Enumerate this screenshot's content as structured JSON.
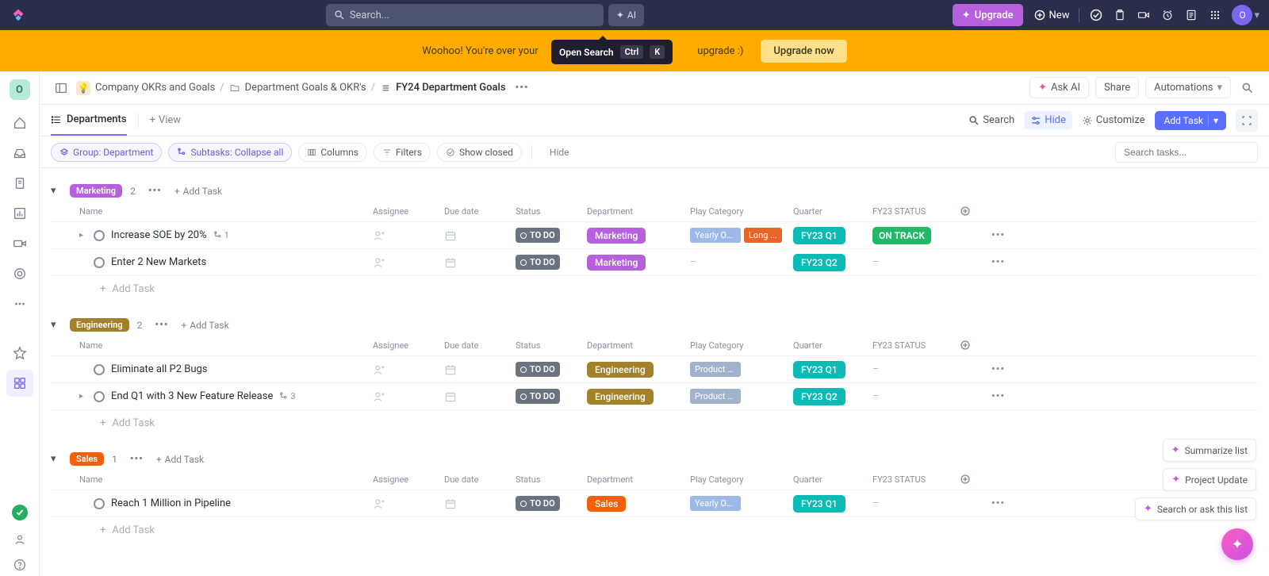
{
  "topnav": {
    "search_placeholder": "Search...",
    "ai_label": "AI",
    "upgrade_label": "Upgrade",
    "new_label": "New",
    "avatar_letter": "O"
  },
  "banner": {
    "text_left": "Woohoo! You're over your",
    "text_right": "upgrade :)",
    "upgrade_label": "Upgrade now"
  },
  "tooltip": {
    "label": "Open Search",
    "key1": "Ctrl",
    "key2": "K"
  },
  "breadcrumb": {
    "folder1": "Company OKRs and Goals",
    "folder2": "Department Goals & OKR's",
    "list": "FY24 Department Goals",
    "ask_ai": "Ask AI",
    "share": "Share",
    "automations": "Automations"
  },
  "workspace_letter": "O",
  "tabs": {
    "active": "Departments",
    "add_view": "View"
  },
  "toolbar": {
    "search": "Search",
    "hide": "Hide",
    "customize": "Customize",
    "add_task": "Add Task"
  },
  "filters": {
    "group": "Group: Department",
    "subtasks": "Subtasks: Collapse all",
    "columns": "Columns",
    "filters": "Filters",
    "show_closed": "Show closed",
    "hide": "Hide",
    "search_placeholder": "Search tasks..."
  },
  "columns": {
    "name": "Name",
    "assignee": "Assignee",
    "due": "Due date",
    "status": "Status",
    "department": "Department",
    "play": "Play Category",
    "quarter": "Quarter",
    "fy23": "FY23 STATUS"
  },
  "groups": [
    {
      "label": "Marketing",
      "pill_class": "pill-marketing",
      "count": "2",
      "tasks": [
        {
          "name": "Increase SOE by 20%",
          "has_expand": true,
          "subtasks": "1",
          "status": "TO DO",
          "department": "Marketing",
          "dept_class": "dept-marketing",
          "plays": [
            {
              "text": "Yearly OK...",
              "cls": "blue"
            },
            {
              "text": "Long ...",
              "cls": "orange"
            }
          ],
          "quarter": "FY23 Q1",
          "fy23": "ON TRACK"
        },
        {
          "name": "Enter 2 New Markets",
          "has_expand": false,
          "status": "TO DO",
          "department": "Marketing",
          "dept_class": "dept-marketing",
          "plays": [],
          "play_empty": "–",
          "quarter": "FY23 Q2",
          "fy23_empty": "–"
        }
      ]
    },
    {
      "label": "Engineering",
      "pill_class": "pill-engineering",
      "count": "2",
      "tasks": [
        {
          "name": "Eliminate all P2 Bugs",
          "has_expand": false,
          "status": "TO DO",
          "department": "Engineering",
          "dept_class": "dept-engineering",
          "plays": [
            {
              "text": "Product Vision and ...",
              "cls": ""
            }
          ],
          "quarter": "FY23 Q1",
          "fy23_empty": "–"
        },
        {
          "name": "End Q1 with 3 New Feature Release",
          "has_expand": true,
          "subtasks": "3",
          "status": "TO DO",
          "department": "Engineering",
          "dept_class": "dept-engineering",
          "plays": [
            {
              "text": "Product Vision and ...",
              "cls": ""
            }
          ],
          "quarter": "FY23 Q2",
          "fy23_empty": "–"
        }
      ]
    },
    {
      "label": "Sales",
      "pill_class": "pill-sales",
      "count": "1",
      "tasks": [
        {
          "name": "Reach 1 Million in Pipeline",
          "has_expand": false,
          "status": "TO DO",
          "department": "Sales",
          "dept_class": "dept-sales",
          "plays": [
            {
              "text": "Yearly OKR Sets",
              "cls": "blue"
            }
          ],
          "quarter": "FY23 Q1",
          "fy23_empty": "–"
        }
      ]
    }
  ],
  "add_task": "Add Task",
  "float": {
    "summarize": "Summarize list",
    "project_update": "Project Update",
    "search_ask": "Search or ask this list"
  }
}
